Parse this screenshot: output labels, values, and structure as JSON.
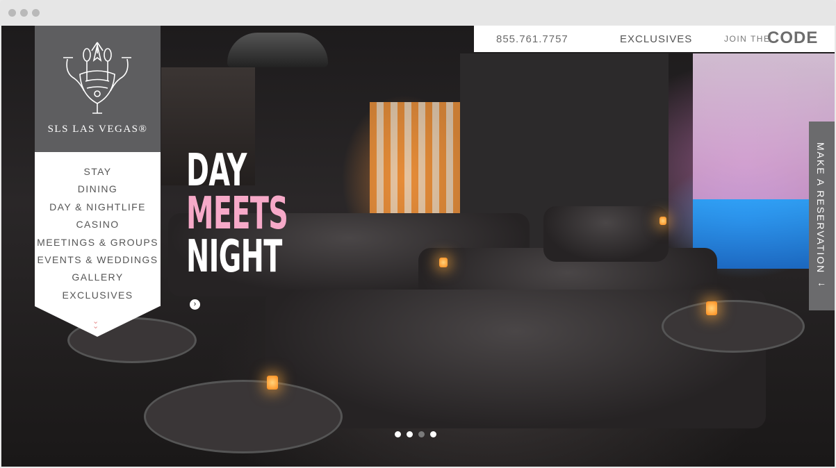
{
  "browser": {
    "controls": [
      "close",
      "minimize",
      "maximize"
    ]
  },
  "topbar": {
    "phone": "855.761.7757",
    "exclusives": "EXCLUSIVES",
    "join_prefix": "JOIN THE",
    "join_code": "CODE"
  },
  "logo": {
    "text": "SLS LAS VEGAS®"
  },
  "nav": {
    "items": [
      {
        "label": "STAY"
      },
      {
        "label": "DINING"
      },
      {
        "label": "DAY & NIGHTLIFE"
      },
      {
        "label": "CASINO"
      },
      {
        "label": "MEETINGS & GROUPS"
      },
      {
        "label": "EVENTS & WEDDINGS"
      },
      {
        "label": "GALLERY"
      },
      {
        "label": "EXCLUSIVES"
      }
    ],
    "expand_icon": "double-chevron-down-icon"
  },
  "hero": {
    "line1": "DAY",
    "line2": "MEETS",
    "line3": "NIGHT",
    "accent_color": "#f6a9c8",
    "arrow_icon": "chevron-right-circle-icon"
  },
  "reservation": {
    "label": "MAKE A RESERVATION",
    "icon": "arrow-left-icon"
  },
  "carousel": {
    "slides": 4,
    "active_index": 2
  }
}
